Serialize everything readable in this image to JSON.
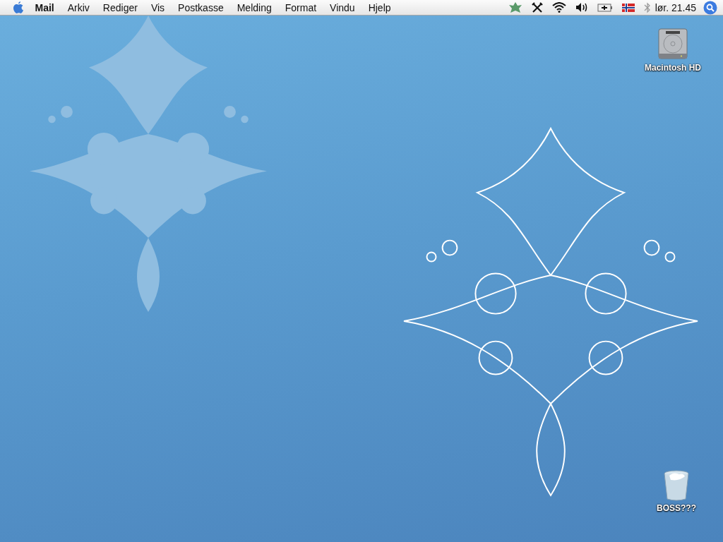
{
  "menu_bar": {
    "app_name": "Mail",
    "menus": [
      "Arkiv",
      "Rediger",
      "Vis",
      "Postkasse",
      "Melding",
      "Format",
      "Vindu",
      "Hjelp"
    ],
    "clock": "lør. 21.45"
  },
  "desktop_icons": [
    {
      "kind": "drive",
      "label": "Macintosh HD"
    },
    {
      "kind": "trash",
      "label": "BOSS???"
    }
  ]
}
